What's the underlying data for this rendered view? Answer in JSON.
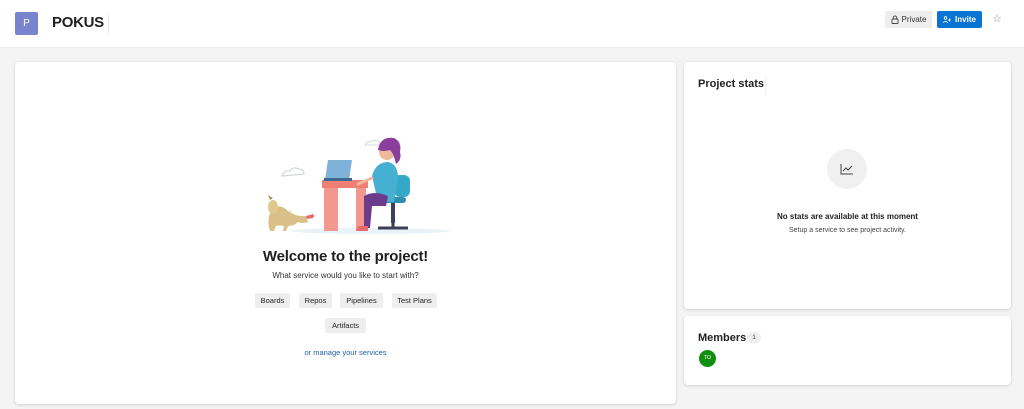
{
  "header": {
    "avatar_letter": "P",
    "project_name": "POKUS",
    "private_label": "Private",
    "invite_label": "Invite",
    "star_glyph": "☆"
  },
  "welcome": {
    "title": "Welcome to the project!",
    "subtitle": "What service would you like to start with?",
    "services": [
      "Boards",
      "Repos",
      "Pipelines",
      "Test Plans",
      "Artifacts"
    ],
    "manage_link": "or manage your services"
  },
  "stats": {
    "title": "Project stats",
    "empty_title": "No stats are available at this moment",
    "empty_subtitle": "Setup a service to see project activity."
  },
  "members": {
    "title": "Members",
    "count": "1",
    "list": [
      {
        "initials": "TO",
        "color": "#108f0f"
      }
    ]
  },
  "colors": {
    "accent": "#0a74d4",
    "project_avatar": "#7a83cd",
    "link": "#1e5fa8"
  }
}
